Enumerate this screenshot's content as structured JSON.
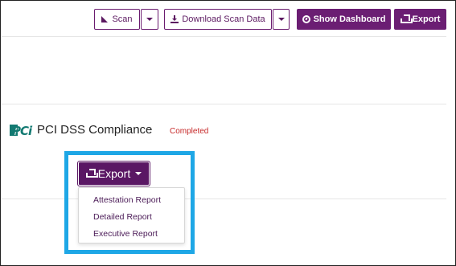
{
  "toolbar": {
    "scan_label": "Scan",
    "download_label": "Download Scan Data",
    "dashboard_label": "Show Dashboard",
    "export_label": "Export"
  },
  "compliance": {
    "logo_text": "PCi",
    "title": "PCI DSS Compliance",
    "status": "Completed"
  },
  "export_menu": {
    "button_label": "Export",
    "items": [
      "Attestation Report",
      "Detailed Report",
      "Executive Report"
    ]
  },
  "colors": {
    "brand_purple": "#6b1e73",
    "status_red": "#c62828",
    "highlight_blue": "#1ea7e6",
    "pci_teal": "#137a72"
  }
}
